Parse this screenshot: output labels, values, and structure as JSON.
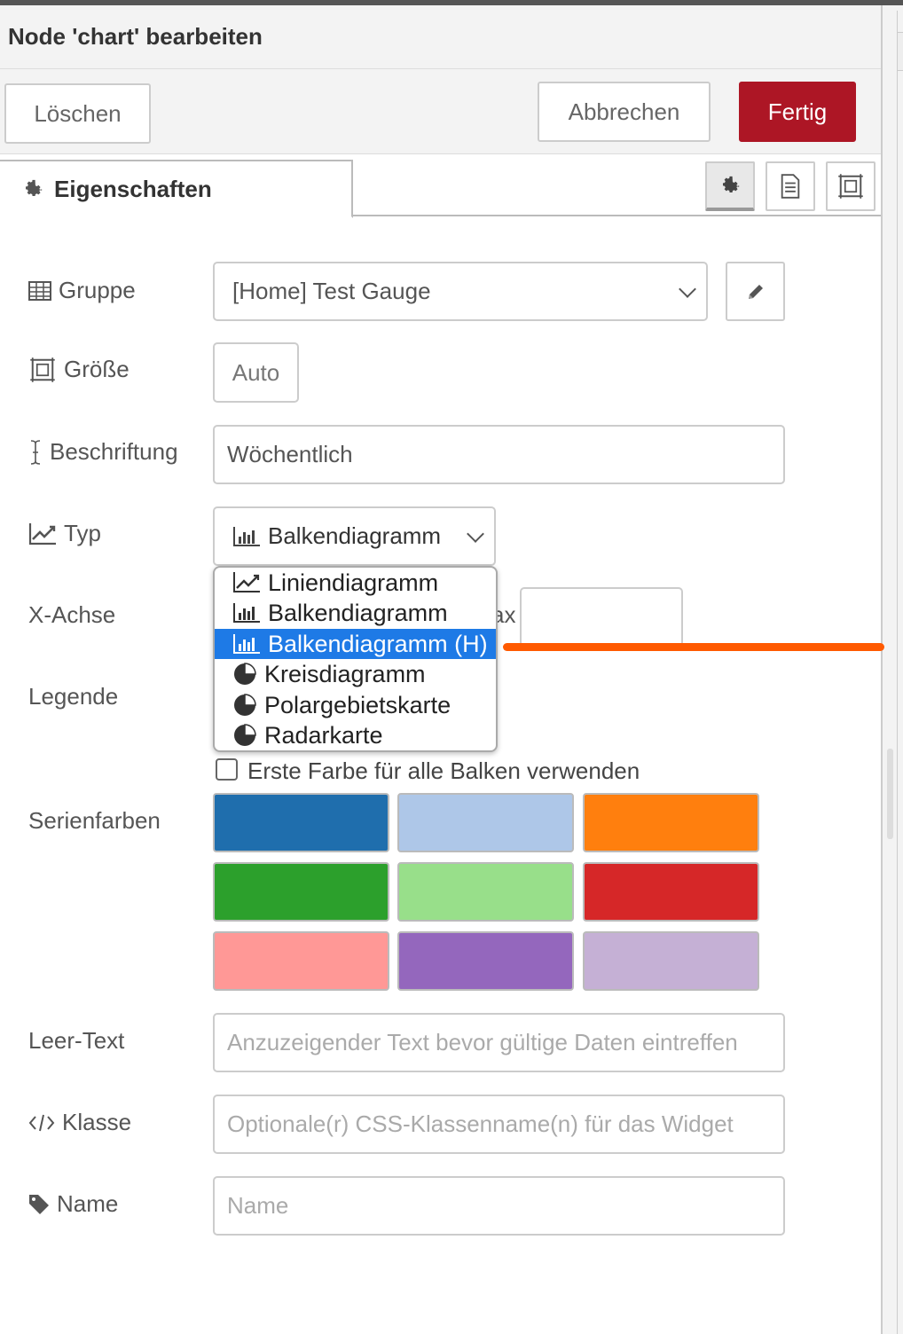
{
  "dialog": {
    "title": "Node 'chart' bearbeiten"
  },
  "actions": {
    "delete_label": "Löschen",
    "cancel_label": "Abbrechen",
    "done_label": "Fertig",
    "done_color": "#ad1625"
  },
  "tabs": {
    "active_label": "Eigenschaften",
    "icons": [
      "gear-icon",
      "document-icon",
      "frame-icon"
    ]
  },
  "form": {
    "group": {
      "label": "Gruppe",
      "value": "[Home] Test Gauge"
    },
    "size": {
      "label": "Größe",
      "value": "Auto"
    },
    "caption": {
      "label": "Beschriftung",
      "value": "Wöchentlich"
    },
    "type": {
      "label": "Typ",
      "value": "Balkendiagramm"
    },
    "xaxis": {
      "label": "X-Achse",
      "partial_max_label": "ax"
    },
    "legend": {
      "label": "Legende"
    },
    "first_color": {
      "label": "Erste Farbe für alle Balken verwenden",
      "checked": false
    },
    "series_colors": {
      "label": "Serienfarben",
      "colors": [
        "#1f6ead",
        "#aec7e8",
        "#ff7f0e",
        "#2ca02c",
        "#98df8a",
        "#d62728",
        "#ff9896",
        "#9467bd",
        "#c5b0d5"
      ]
    },
    "empty_text": {
      "label": "Leer-Text",
      "placeholder": "Anzuzeigender Text bevor gültige Daten eintreffen"
    },
    "class": {
      "label": "Klasse",
      "placeholder": "Optionale(r) CSS-Klassenname(n) für das Widget"
    },
    "name": {
      "label": "Name",
      "placeholder": "Name"
    }
  },
  "type_dropdown": {
    "selected_index": 2,
    "items": [
      {
        "label": "Liniendiagramm",
        "icon": "line-chart-icon"
      },
      {
        "label": "Balkendiagramm",
        "icon": "bar-chart-icon"
      },
      {
        "label": "Balkendiagramm (H)",
        "icon": "bar-chart-icon"
      },
      {
        "label": "Kreisdiagramm",
        "icon": "pie-chart-icon"
      },
      {
        "label": "Polargebietskarte",
        "icon": "pie-chart-icon"
      },
      {
        "label": "Radarkarte",
        "icon": "pie-chart-icon"
      }
    ]
  },
  "annotation": {
    "color": "#ff5a00"
  }
}
